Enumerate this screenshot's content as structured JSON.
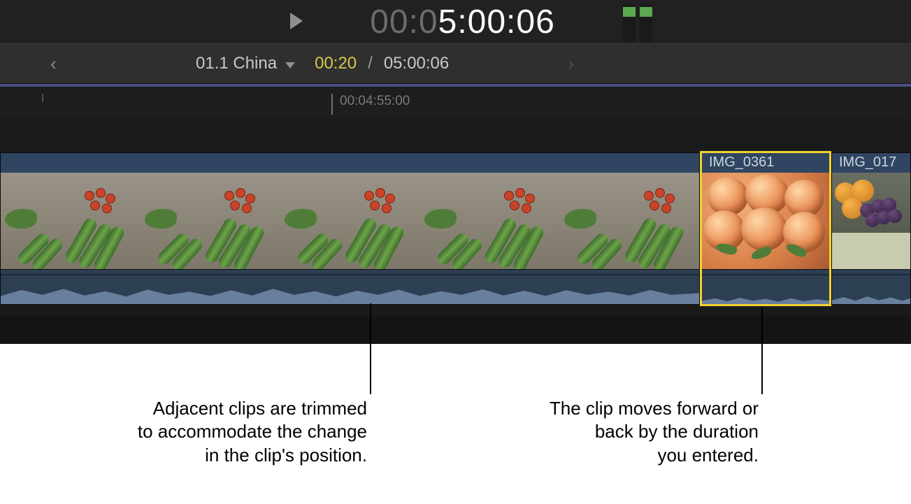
{
  "timecode": {
    "dim_prefix": "00:0",
    "bright": "5:00:06"
  },
  "nav": {
    "project_name": "01.1 China",
    "elapsed": "00:20",
    "separator": "/",
    "total": "05:00:06"
  },
  "ruler": {
    "label": "00:04:55:00"
  },
  "clips": {
    "selected_label": "IMG_0361",
    "right_label": "IMG_017"
  },
  "annotations": {
    "left": "Adjacent clips are trimmed\nto accommodate the change\nin the clip's position.",
    "right": "The clip moves forward or\nback by the duration\nyou entered."
  }
}
